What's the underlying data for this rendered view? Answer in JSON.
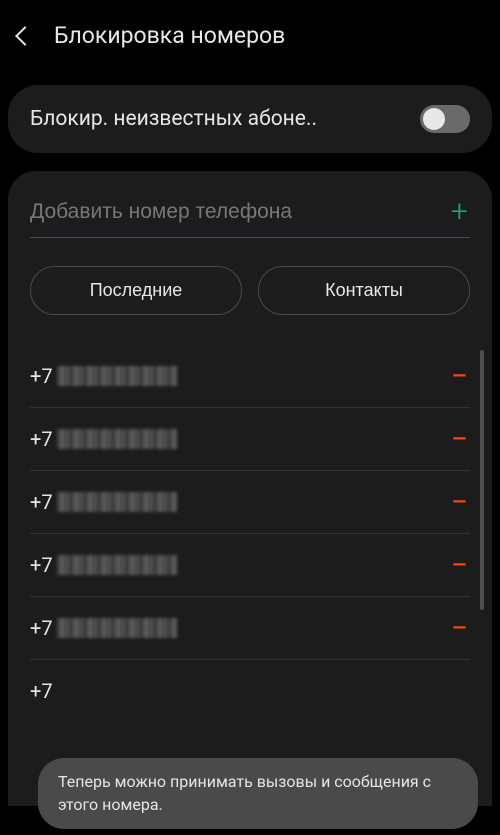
{
  "header": {
    "title": "Блокировка номеров"
  },
  "toggle": {
    "label": "Блокир. неизвестных абоне.."
  },
  "input": {
    "placeholder": "Добавить номер телефона"
  },
  "tabs": {
    "recent": "Последние",
    "contacts": "Контакты"
  },
  "numbers": [
    {
      "prefix": "+7"
    },
    {
      "prefix": "+7"
    },
    {
      "prefix": "+7"
    },
    {
      "prefix": "+7"
    },
    {
      "prefix": "+7"
    },
    {
      "prefix": "+7"
    }
  ],
  "toast": {
    "message": "Теперь можно принимать вызовы и сообщения с этого номера."
  }
}
